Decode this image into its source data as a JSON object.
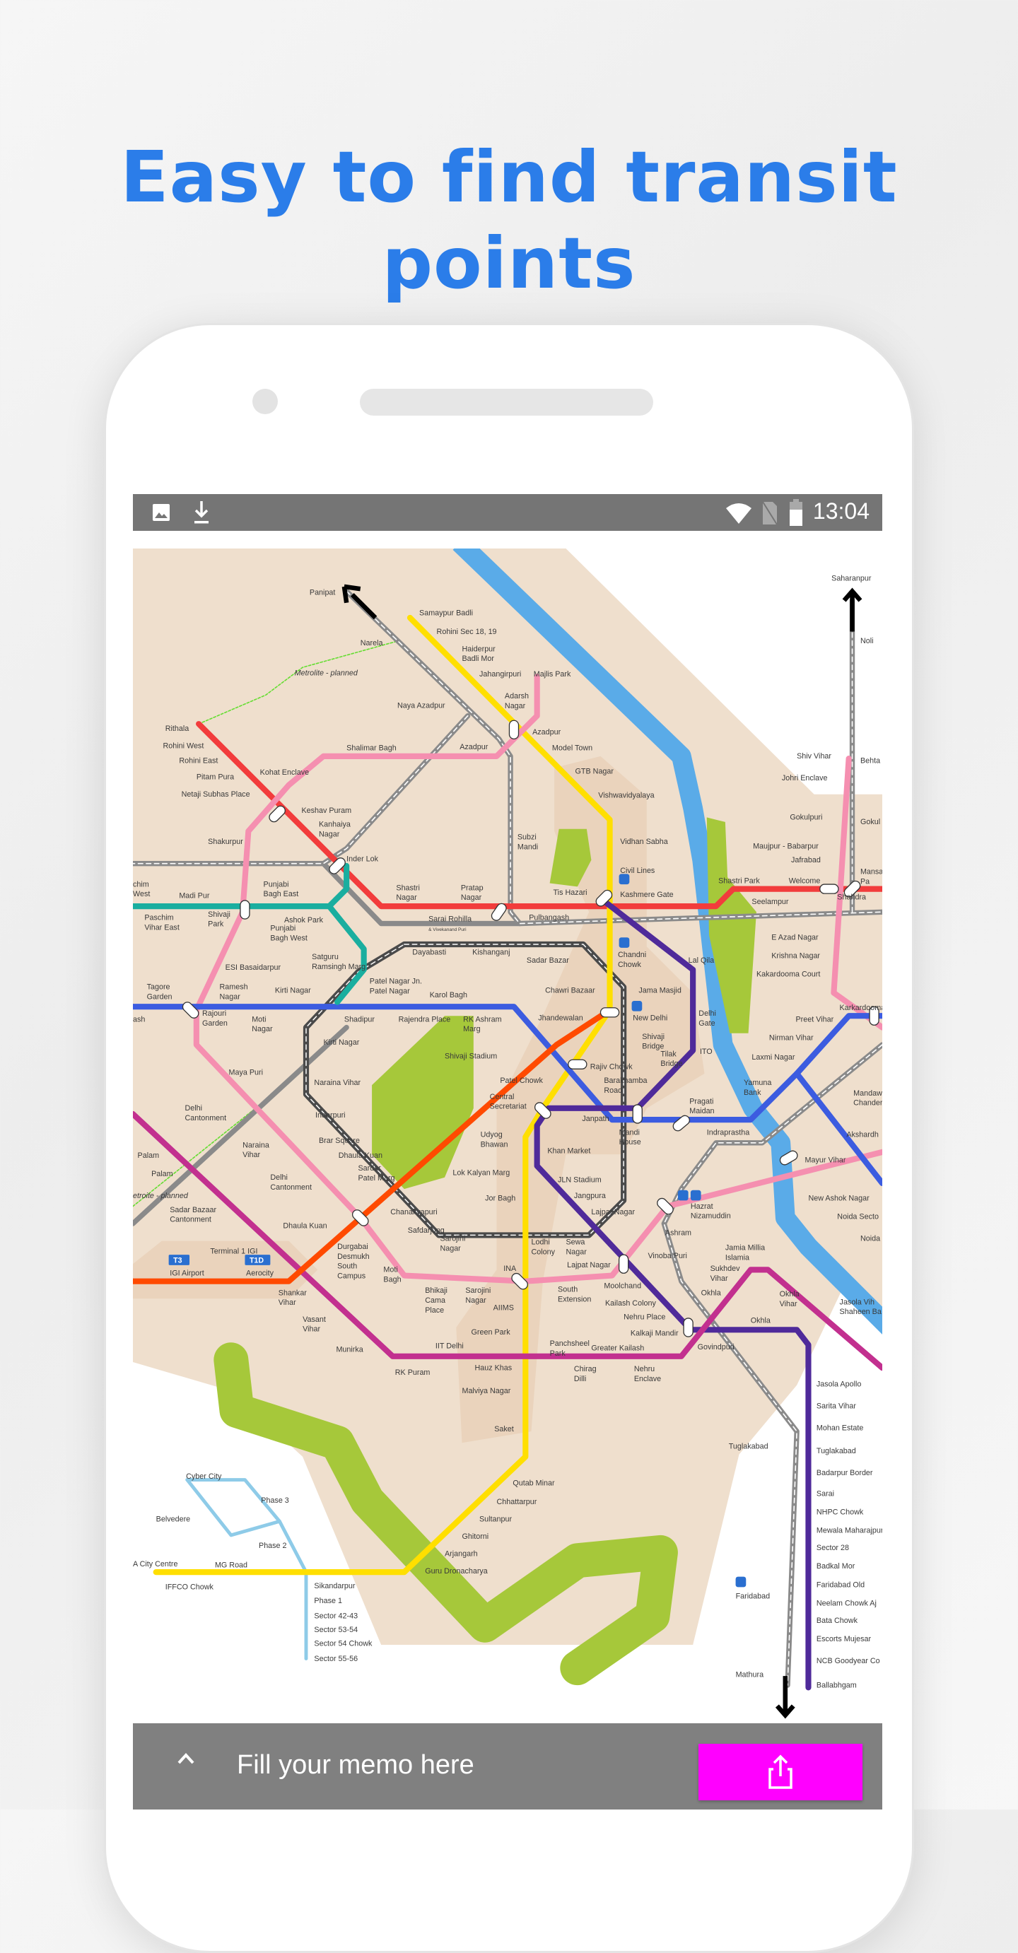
{
  "headline": {
    "line1": "Easy to find transit",
    "line2": "points"
  },
  "status_bar": {
    "time": "13:04",
    "left_icons": [
      "image-icon",
      "download-icon"
    ],
    "right_icons": [
      "wifi-icon",
      "no-sim-icon",
      "battery-icon"
    ]
  },
  "bottom_bar": {
    "memo_placeholder": "Fill your memo here",
    "expand_icon": "chevron-up-icon",
    "share_icon": "share-icon",
    "share_color": "#ff00ff"
  },
  "colors": {
    "headline": "#2b7de9",
    "status_bar": "#757575",
    "bottom_bar": "#808080",
    "land": "#efdfcd",
    "river": "#5aabe8",
    "park": "#a6c83a",
    "lines": {
      "red": "#f23c3c",
      "yellow": "#ffdf00",
      "pink": "#f58fb0",
      "blue": "#3c5ce0",
      "green": "#1aae9f",
      "violet": "#4f2a9a",
      "magenta": "#c2308f",
      "orange": "#ff4a00",
      "grey": "#4a4a4a",
      "rapid_metro": "#8ecbe8"
    }
  },
  "map": {
    "badges": [
      "T3",
      "T1D"
    ],
    "stations": [
      "Panipat",
      "Samaypur Badli",
      "Rohini Sec 18, 19",
      [
        "Haiderpur",
        "Badli Mor"
      ],
      "Jahangirpuri",
      "Majlis Park",
      "Narela",
      "Metrolite - planned",
      "Naya Azadpur",
      [
        "Adarsh",
        "Nagar"
      ],
      "Azadpur",
      "Azadpur",
      "Rithala",
      "Rohini West",
      "Rohini East",
      "Pitam Pura",
      "Netaji Subhas Place",
      "Kohat Enclave",
      "Shalimar Bagh",
      "Model Town",
      "GTB Nagar",
      "Vishwavidyalaya",
      "Keshav Puram",
      [
        "Kanhaiya",
        "Nagar"
      ],
      "Shakurpur",
      "Inder Lok",
      "Vidhan Sabha",
      "Civil Lines",
      [
        "Subzi",
        "Mandi"
      ],
      [
        "Shastri",
        "Nagar"
      ],
      [
        "Pratap",
        "Nagar"
      ],
      "Tis Hazari",
      "Kashmere Gate",
      "Pulbangash",
      [
        "chim",
        "West"
      ],
      "Madi Pur",
      [
        "Punjabi",
        "Bagh East"
      ],
      [
        "Paschim",
        "Vihar East"
      ],
      [
        "Shivaji",
        "Park"
      ],
      "Ashok Park",
      [
        "Punjabi",
        "Bagh West"
      ],
      [
        "Sarai Rohilla",
        "& Vivekanand Puri"
      ],
      "Dayabasti",
      "Kishanganj",
      "Sadar Bazar",
      [
        "Chandni",
        "Chowk"
      ],
      "Lal Qila",
      "ESI Basaidarpur",
      [
        "Satguru",
        "Ramsingh Marg"
      ],
      [
        "Tagore",
        "Garden"
      ],
      [
        "Ramesh",
        "Nagar"
      ],
      "Kirti Nagar",
      [
        "Patel Nagar Jn.",
        "Patel Nagar"
      ],
      "Karol Bagh",
      "Chawri Bazaar",
      "Jama Masjid",
      "Shadipur",
      "Rajendra Place",
      [
        "RK Ashram",
        "Marg"
      ],
      "Jhandewalan",
      "New Delhi",
      [
        "Delhi",
        "Gate"
      ],
      [
        "Rajouri",
        "Garden"
      ],
      [
        "Moti",
        "Nagar"
      ],
      "ash",
      "Kirti Nagar",
      "Shivaji Stadium",
      [
        "Shivaji",
        "Bridge"
      ],
      [
        "Tilak",
        "Bridge"
      ],
      "ITO",
      "Rajiv Chowk",
      "Patel Chowk",
      [
        "Barakhamba",
        "Road"
      ],
      "Maya Puri",
      "Naraina Vihar",
      [
        "Central",
        "Secretariat"
      ],
      "Janpath",
      [
        "Pragati",
        "Maidan"
      ],
      "Indraprastha",
      [
        "Mandi",
        "House"
      ],
      "Inderpuri",
      [
        "Delhi",
        "Cantonment"
      ],
      [
        "Udyog",
        "Bhawan"
      ],
      "Brar Square",
      [
        "Naraina",
        "Vihar"
      ],
      "Khan Market",
      "Dhaula Kuan",
      [
        "Sardar",
        "Patel Marg"
      ],
      "Palam",
      "Palam",
      "Lok Kalyan Marg",
      [
        "Delhi",
        "Cantonment"
      ],
      "JLN Stadium",
      "Jangpura",
      "Jor Bagh",
      "Lajpat Nagar",
      [
        "Hazrat",
        "Nizamuddin"
      ],
      "Chanakyapuri",
      [
        "Sadar Bazaar",
        "Cantonment"
      ],
      "etroite - planned",
      "Dhaula Kuan",
      "Safdarjung",
      [
        "Sarojini",
        "Nagar"
      ],
      [
        "Lodhi",
        "Colony"
      ],
      [
        "Sewa",
        "Nagar"
      ],
      "Ashram",
      "Vinoba Puri",
      [
        "Jamia Millia",
        "Islamia"
      ],
      "Terminal 1 IGI",
      "IGI Airport",
      "Aerocity",
      [
        "Durgabai",
        "Desmukh",
        "South",
        "Campus"
      ],
      [
        "Moti",
        "Bagh"
      ],
      "INA",
      "Lajpat Nagar",
      "Moolchand",
      [
        "Sukhdev",
        "Vihar"
      ],
      [
        "Shankar",
        "Vihar"
      ],
      [
        "Bhikaji",
        "Cama",
        "Place"
      ],
      [
        "Sarojini",
        "Nagar"
      ],
      "AIIMS",
      [
        "South",
        "Extension"
      ],
      "Kailash Colony",
      "Okhla",
      [
        "Okhla",
        "Vihar"
      ],
      [
        "Jasola Vih",
        "Shaheen Ba"
      ],
      "Nehru Place",
      "Okhla",
      [
        "Vasant",
        "Vihar"
      ],
      "Green Park",
      "Kalkaji Mandir",
      "Govindpuri",
      "Munirka",
      "IIT Delhi",
      [
        "Panchsheel",
        "Park"
      ],
      "Greater Kailash",
      "RK Puram",
      "Hauz Khas",
      [
        "Chirag",
        "Dilli"
      ],
      [
        "Nehru",
        "Enclave"
      ],
      "Jasola Apollo",
      "Malviya Nagar",
      "Sarita Vihar",
      "Mohan Estate",
      "Saket",
      "Tuglakabad",
      "Tuglakabad",
      "Badarpur Border",
      "Cyber City",
      "Qutab Minar",
      "Phase 3",
      "Sarai",
      "Chhattarpur",
      "Belvedere",
      "NHPC Chowk",
      "Sultanpur",
      "Mewala Maharajpur",
      "Ghitorni",
      "Phase 2",
      "Sector 28",
      "Arjangarh",
      "A City Centre",
      "MG Road",
      "Badkal Mor",
      "Guru Dronacharya",
      "IFFCO Chowk",
      "Sikandarpur",
      "Faridabad Old",
      "Faridabad",
      "Phase 1",
      "Neelam Chowk Aj",
      "Sector 42-43",
      "Bata Chowk",
      "Sector 53-54",
      "Escorts Mujesar",
      "Sector 54 Chowk",
      "NCB Goodyear Co",
      "Sector 55-56",
      "Mathura",
      "Ballabhgam",
      "Saharanpur",
      "Noli",
      "Shiv Vihar",
      "Behta",
      "Johri Enclave",
      "Gokulpuri",
      "Gokul",
      "Maujpur - Babarpur",
      "Jafrabad",
      [
        "Mansa",
        "Pa"
      ],
      "Shastri Park",
      "Welcome",
      "Shahdra",
      "Seelampur",
      "E Azad Nagar",
      "Krishna Nagar",
      "Kakardooma Court",
      "Karkardooma",
      "Preet Vihar",
      "Nirman Vihar",
      "Laxmi Nagar",
      [
        "Yamuna",
        "Bank"
      ],
      [
        "Mandaw",
        "Chander"
      ],
      "Akshardh",
      "Mayur Vihar",
      "New Ashok Nagar",
      "Noida Secto",
      "Noida"
    ]
  }
}
